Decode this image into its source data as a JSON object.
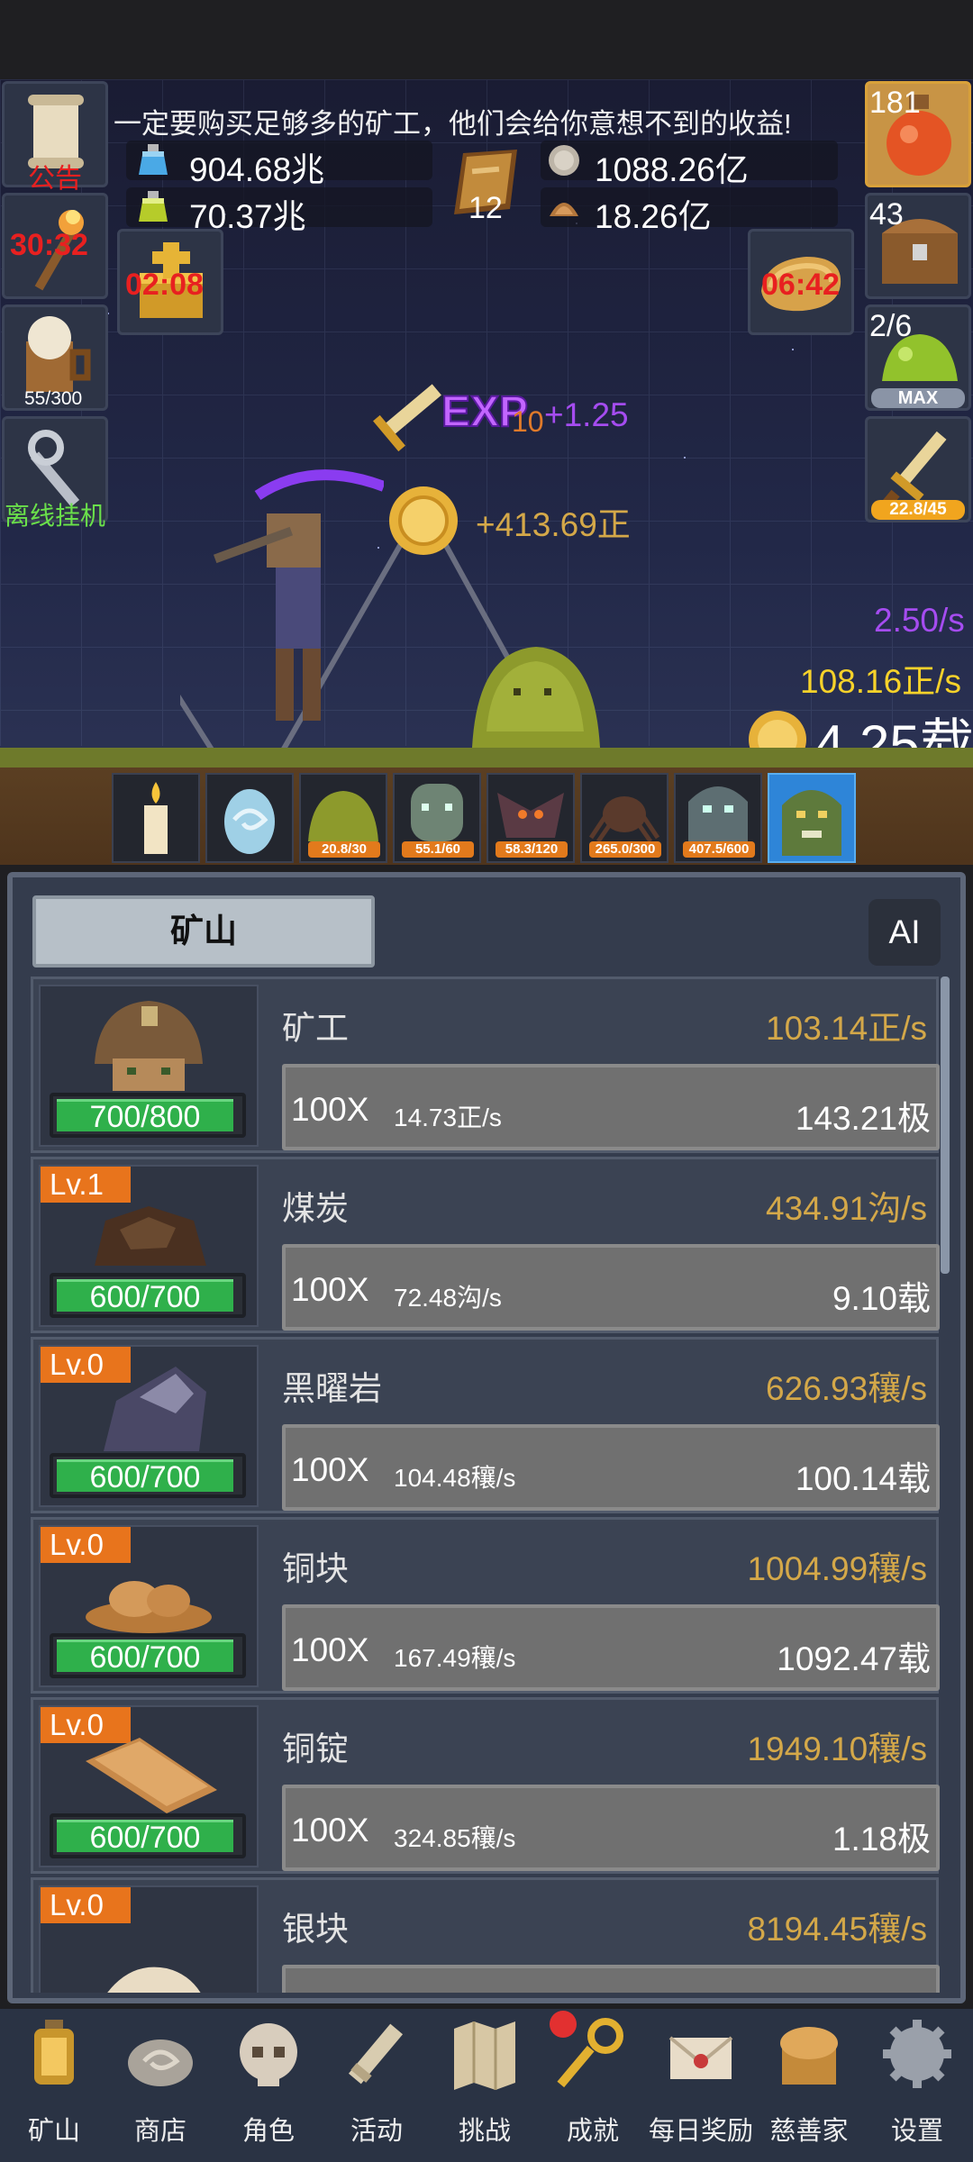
{
  "top": {
    "notice": "一定要购买足够多的矿工，他们会给你意想不到的收益!",
    "resources": {
      "blue_potion": "904.68兆",
      "green_potion": "70.37兆",
      "book_count": "12",
      "coin": "1088.26亿",
      "shell": "18.26亿"
    },
    "left_buttons": {
      "announcement": "公告",
      "torch_timer": "30:32",
      "beer": "55/300",
      "offline": "离线挂机"
    },
    "chest_timer": "02:08",
    "bread_timer": "06:42",
    "right_buttons": {
      "potion_count": "181",
      "chest_count": "43",
      "slime_count": "2/6",
      "slime_tag": "MAX",
      "sword_count": "22.8/45"
    }
  },
  "scene": {
    "exp_label": "EXP",
    "exp_level": "10",
    "exp_gain": "+1.25",
    "coin_gain": "+413.69正",
    "exp_rate": "2.50/s",
    "coin_rate": "108.16正/s",
    "total": "4.25载",
    "enemies": [
      {
        "name": "candle",
        "progress": ""
      },
      {
        "name": "egg",
        "progress": ""
      },
      {
        "name": "slime",
        "progress": "20.8/30"
      },
      {
        "name": "ghoul",
        "progress": "55.1/60"
      },
      {
        "name": "bat",
        "progress": "58.3/120"
      },
      {
        "name": "spider",
        "progress": "265.0/300"
      },
      {
        "name": "ghost",
        "progress": "407.5/600"
      },
      {
        "name": "orc",
        "progress": ""
      }
    ]
  },
  "panel": {
    "tab": "矿山",
    "ai": "AI",
    "rows": [
      {
        "lv": "",
        "stock": "700/800",
        "name": "矿工",
        "rate": "103.14正/s",
        "mult": "100X",
        "unit": "14.73正/s",
        "cost": "143.21极"
      },
      {
        "lv": "Lv.1",
        "stock": "600/700",
        "name": "煤炭",
        "rate": "434.91沟/s",
        "mult": "100X",
        "unit": "72.48沟/s",
        "cost": "9.10载"
      },
      {
        "lv": "Lv.0",
        "stock": "600/700",
        "name": "黑曜岩",
        "rate": "626.93穰/s",
        "mult": "100X",
        "unit": "104.48穰/s",
        "cost": "100.14载"
      },
      {
        "lv": "Lv.0",
        "stock": "600/700",
        "name": "铜块",
        "rate": "1004.99穰/s",
        "mult": "100X",
        "unit": "167.49穰/s",
        "cost": "1092.47载"
      },
      {
        "lv": "Lv.0",
        "stock": "600/700",
        "name": "铜锭",
        "rate": "1949.10穰/s",
        "mult": "100X",
        "unit": "324.85穰/s",
        "cost": "1.18极"
      },
      {
        "lv": "Lv.0",
        "stock": "",
        "name": "银块",
        "rate": "8194.45穰/s",
        "mult": "",
        "unit": "",
        "cost": ""
      }
    ]
  },
  "nav": [
    {
      "label": "矿山",
      "icon": "lantern-icon"
    },
    {
      "label": "商店",
      "icon": "shop-icon"
    },
    {
      "label": "角色",
      "icon": "skull-icon"
    },
    {
      "label": "活动",
      "icon": "scroll-icon"
    },
    {
      "label": "挑战",
      "icon": "map-icon"
    },
    {
      "label": "成就",
      "icon": "key-icon"
    },
    {
      "label": "每日奖励",
      "icon": "envelope-icon"
    },
    {
      "label": "慈善家",
      "icon": "bread-icon"
    },
    {
      "label": "设置",
      "icon": "gear-icon"
    }
  ],
  "colors": {
    "exp_purple": "#a54cf0",
    "coin_gold": "#d4a849",
    "rate_yellow": "#f7d22a",
    "timer_red": "#e82020",
    "stock_green": "#2fb04b",
    "level_orange": "#e8741c",
    "active_slot_blue": "#2e85d8"
  }
}
